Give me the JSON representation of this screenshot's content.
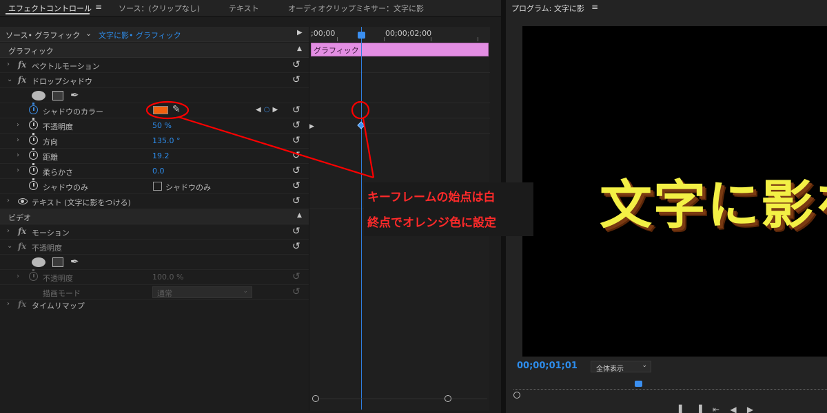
{
  "tabs": {
    "effect_controls": "エフェクトコントロール",
    "source": "ソース：(クリップなし)",
    "text": "テキスト",
    "audio_mixer": "オーディオクリップミキサー：文字に影",
    "menu_glyph": "≡"
  },
  "effect_controls": {
    "source_label": "ソース• グラフィック",
    "clip_label": "文字に影• グラフィック",
    "sections": {
      "graphics": "グラフィック",
      "video": "ビデオ"
    },
    "rows": {
      "vector_motion": "ベクトルモーション",
      "drop_shadow": "ドロップシャドウ",
      "shadow_color": "シャドウのカラー",
      "opacity": "不透明度",
      "opacity_value": "50 %",
      "direction": "方向",
      "direction_value": "135.0 °",
      "distance": "距離",
      "distance_value": "19.2",
      "softness": "柔らかさ",
      "softness_value": "0.0",
      "shadow_only": "シャドウのみ",
      "shadow_only_checkbox": "シャドウのみ",
      "text_layer": "テキスト (文字に影をつける)",
      "motion": "モーション",
      "video_opacity": "不透明度",
      "video_opacity_prop": "不透明度",
      "video_opacity_value": "100.0 %",
      "blend_mode": "描画モード",
      "blend_mode_value": "通常",
      "time_remap": "タイムリマップ"
    },
    "shadow_color_hex": "#f2600e",
    "accent_color": "#2d8ceb"
  },
  "timeline": {
    "start_tc": ";00;00",
    "mid_tc": "00;00;02;00",
    "clip_label": "グラフィック"
  },
  "program": {
    "title": "プログラム: 文字に影",
    "menu_glyph": "≡",
    "frame_text": "文字に影を",
    "timecode": "00;00;01;01",
    "zoom": "全体表示"
  },
  "annotation": {
    "line1": "キーフレームの始点は白",
    "line2": "終点でオレンジ色に設定",
    "color": "#ff0000"
  }
}
